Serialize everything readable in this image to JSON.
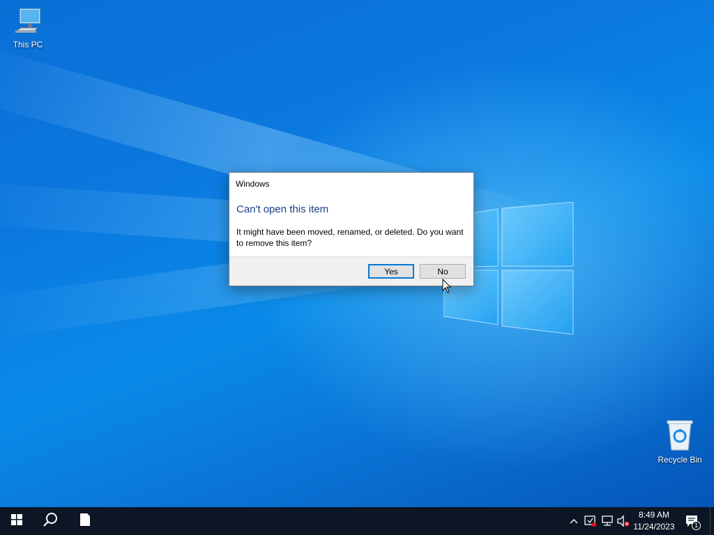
{
  "desktop": {
    "icons": [
      {
        "label": "This PC",
        "icon": "monitor-icon"
      },
      {
        "label": "Recycle Bin",
        "icon": "recycle-bin-icon"
      }
    ]
  },
  "dialog": {
    "title": "Windows",
    "heading": "Can't open this item",
    "message": "It might have been moved, renamed, or deleted. Do you want to remove this item?",
    "yes_label": "Yes",
    "no_label": "No",
    "heading_color": "#1b3e8a",
    "default_button_color": "#0078d7"
  },
  "taskbar": {
    "start_icon": "windows-logo-icon",
    "search_icon": "search-icon",
    "pinned_icon": "file-icon",
    "tray": {
      "icons": [
        "chevron-up-icon",
        "security-icon",
        "network-icon",
        "volume-muted-icon"
      ],
      "time": "8:49 AM",
      "date": "11/24/2023",
      "notification_count": "1"
    }
  },
  "colors": {
    "taskbar": "#0c1624",
    "wallpaper": "#0a74d6"
  }
}
